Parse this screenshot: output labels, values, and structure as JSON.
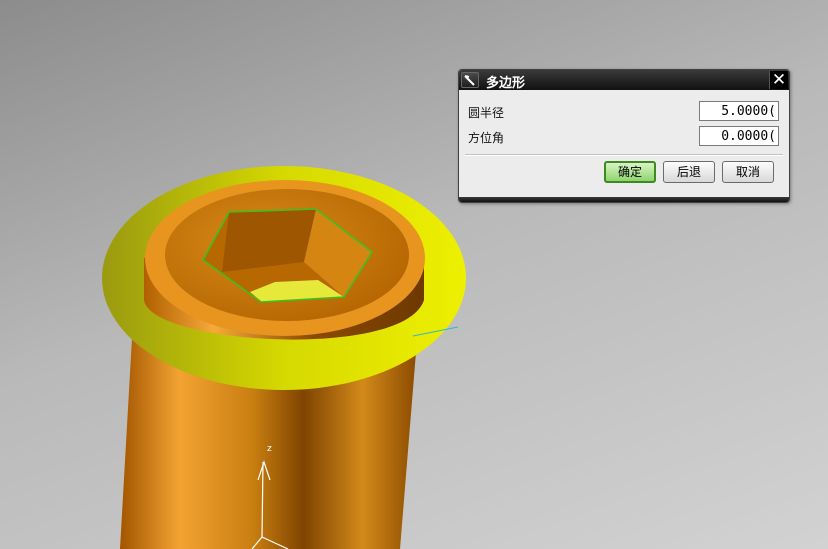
{
  "dialog": {
    "title": "多边形",
    "close_glyph": "✕",
    "fields": [
      {
        "label": "圆半径",
        "value": "5.0000("
      },
      {
        "label": "方位角",
        "value": "0.0000("
      }
    ],
    "buttons": {
      "ok": "确定",
      "back": "后退",
      "cancel": "取消"
    }
  },
  "viewport": {
    "axis_label": "z",
    "colors": {
      "part": "#c87a00",
      "hub": "#d9dc00",
      "sketch": "#3fbf1f"
    }
  }
}
